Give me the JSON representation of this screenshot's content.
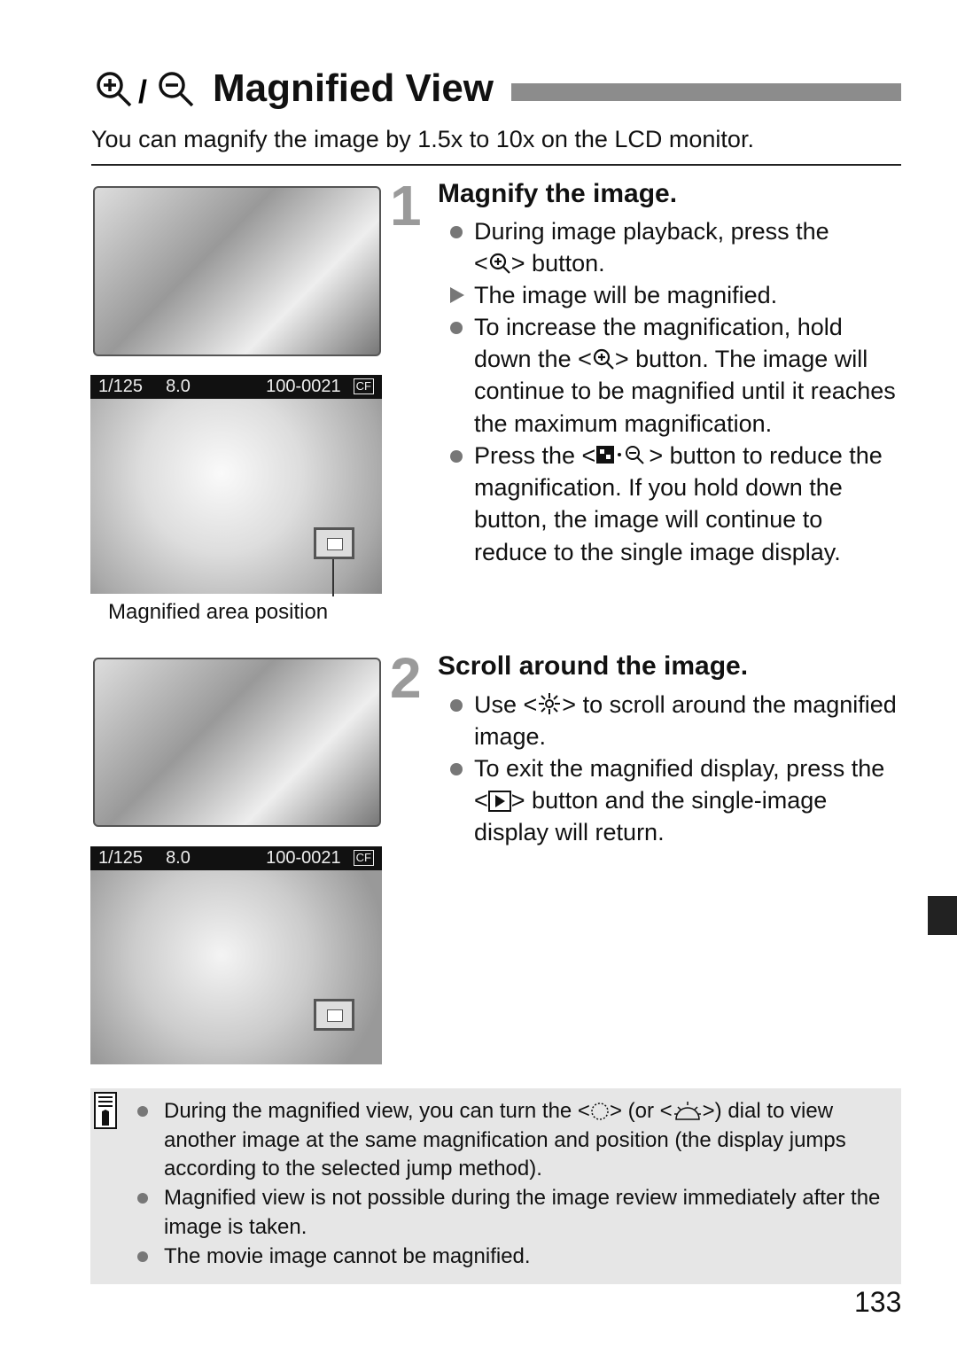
{
  "header": {
    "title": "Magnified View",
    "title_icons": [
      "magnify-plus-icon",
      "magnify-minus-icon"
    ],
    "separator": "/",
    "intro": "You can magnify the image by 1.5x to 10x on the LCD monitor."
  },
  "step1": {
    "number": "1",
    "heading": "Magnify the image.",
    "items": [
      {
        "a": "During image playback, press the",
        "b": "<",
        "c": "> button."
      },
      {
        "a": "The image will be magnified."
      },
      {
        "a": "To increase the magnification, hold down the <",
        "c": "> button. The image will continue to be magnified until it reaches the maximum magnification."
      },
      {
        "a": "Press the <",
        "c": "> button to reduce the magnification. If you hold down the button, the image will continue to reduce to the single image display."
      }
    ]
  },
  "lcd": {
    "shutter": "1/125",
    "aperture": "8.0",
    "file": "100-0021",
    "card": "CF"
  },
  "caption": "Magnified area position",
  "step2": {
    "number": "2",
    "heading": "Scroll around the image.",
    "items": [
      {
        "a": "Use <",
        "c": "> to scroll around the magnified image."
      },
      {
        "a": "To exit the magnified display, press the <",
        "c": "> button and the single-image display will return."
      }
    ]
  },
  "note": {
    "items": [
      {
        "a": "During the magnified view, you can turn the <",
        "b": "> (or <",
        "c": ">) dial to view another image at the same magnification and position (the display jumps according to the selected jump method)."
      },
      {
        "a": "Magnified view is not possible during the image review immediately after the image is taken."
      },
      {
        "a": "The movie image cannot be magnified."
      }
    ]
  },
  "page_number": "133",
  "colors": {
    "title_bar": "#8c8c8c",
    "note_bg": "#e6e6e6",
    "step_number": "#9a9a9a",
    "side_tab": "#222222"
  }
}
